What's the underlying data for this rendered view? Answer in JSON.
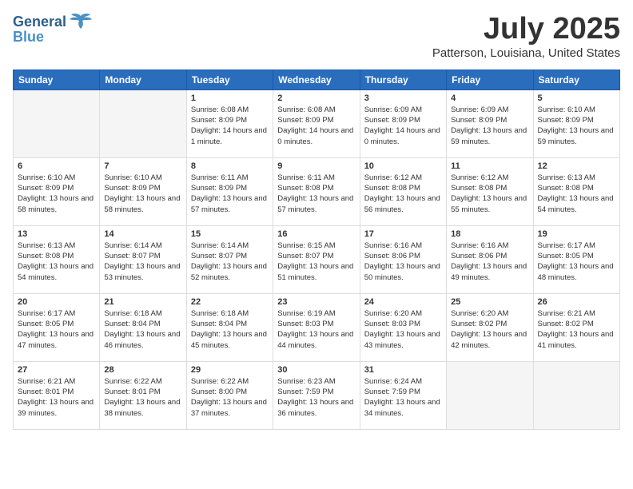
{
  "header": {
    "logo_general": "General",
    "logo_blue": "Blue",
    "month": "July 2025",
    "location": "Patterson, Louisiana, United States"
  },
  "weekdays": [
    "Sunday",
    "Monday",
    "Tuesday",
    "Wednesday",
    "Thursday",
    "Friday",
    "Saturday"
  ],
  "weeks": [
    [
      {
        "day": "",
        "empty": true
      },
      {
        "day": "",
        "empty": true
      },
      {
        "day": "1",
        "sunrise": "6:08 AM",
        "sunset": "8:09 PM",
        "daylight": "14 hours and 1 minute."
      },
      {
        "day": "2",
        "sunrise": "6:08 AM",
        "sunset": "8:09 PM",
        "daylight": "14 hours and 0 minutes."
      },
      {
        "day": "3",
        "sunrise": "6:09 AM",
        "sunset": "8:09 PM",
        "daylight": "14 hours and 0 minutes."
      },
      {
        "day": "4",
        "sunrise": "6:09 AM",
        "sunset": "8:09 PM",
        "daylight": "13 hours and 59 minutes."
      },
      {
        "day": "5",
        "sunrise": "6:10 AM",
        "sunset": "8:09 PM",
        "daylight": "13 hours and 59 minutes."
      }
    ],
    [
      {
        "day": "6",
        "sunrise": "6:10 AM",
        "sunset": "8:09 PM",
        "daylight": "13 hours and 58 minutes."
      },
      {
        "day": "7",
        "sunrise": "6:10 AM",
        "sunset": "8:09 PM",
        "daylight": "13 hours and 58 minutes."
      },
      {
        "day": "8",
        "sunrise": "6:11 AM",
        "sunset": "8:09 PM",
        "daylight": "13 hours and 57 minutes."
      },
      {
        "day": "9",
        "sunrise": "6:11 AM",
        "sunset": "8:08 PM",
        "daylight": "13 hours and 57 minutes."
      },
      {
        "day": "10",
        "sunrise": "6:12 AM",
        "sunset": "8:08 PM",
        "daylight": "13 hours and 56 minutes."
      },
      {
        "day": "11",
        "sunrise": "6:12 AM",
        "sunset": "8:08 PM",
        "daylight": "13 hours and 55 minutes."
      },
      {
        "day": "12",
        "sunrise": "6:13 AM",
        "sunset": "8:08 PM",
        "daylight": "13 hours and 54 minutes."
      }
    ],
    [
      {
        "day": "13",
        "sunrise": "6:13 AM",
        "sunset": "8:08 PM",
        "daylight": "13 hours and 54 minutes."
      },
      {
        "day": "14",
        "sunrise": "6:14 AM",
        "sunset": "8:07 PM",
        "daylight": "13 hours and 53 minutes."
      },
      {
        "day": "15",
        "sunrise": "6:14 AM",
        "sunset": "8:07 PM",
        "daylight": "13 hours and 52 minutes."
      },
      {
        "day": "16",
        "sunrise": "6:15 AM",
        "sunset": "8:07 PM",
        "daylight": "13 hours and 51 minutes."
      },
      {
        "day": "17",
        "sunrise": "6:16 AM",
        "sunset": "8:06 PM",
        "daylight": "13 hours and 50 minutes."
      },
      {
        "day": "18",
        "sunrise": "6:16 AM",
        "sunset": "8:06 PM",
        "daylight": "13 hours and 49 minutes."
      },
      {
        "day": "19",
        "sunrise": "6:17 AM",
        "sunset": "8:05 PM",
        "daylight": "13 hours and 48 minutes."
      }
    ],
    [
      {
        "day": "20",
        "sunrise": "6:17 AM",
        "sunset": "8:05 PM",
        "daylight": "13 hours and 47 minutes."
      },
      {
        "day": "21",
        "sunrise": "6:18 AM",
        "sunset": "8:04 PM",
        "daylight": "13 hours and 46 minutes."
      },
      {
        "day": "22",
        "sunrise": "6:18 AM",
        "sunset": "8:04 PM",
        "daylight": "13 hours and 45 minutes."
      },
      {
        "day": "23",
        "sunrise": "6:19 AM",
        "sunset": "8:03 PM",
        "daylight": "13 hours and 44 minutes."
      },
      {
        "day": "24",
        "sunrise": "6:20 AM",
        "sunset": "8:03 PM",
        "daylight": "13 hours and 43 minutes."
      },
      {
        "day": "25",
        "sunrise": "6:20 AM",
        "sunset": "8:02 PM",
        "daylight": "13 hours and 42 minutes."
      },
      {
        "day": "26",
        "sunrise": "6:21 AM",
        "sunset": "8:02 PM",
        "daylight": "13 hours and 41 minutes."
      }
    ],
    [
      {
        "day": "27",
        "sunrise": "6:21 AM",
        "sunset": "8:01 PM",
        "daylight": "13 hours and 39 minutes."
      },
      {
        "day": "28",
        "sunrise": "6:22 AM",
        "sunset": "8:01 PM",
        "daylight": "13 hours and 38 minutes."
      },
      {
        "day": "29",
        "sunrise": "6:22 AM",
        "sunset": "8:00 PM",
        "daylight": "13 hours and 37 minutes."
      },
      {
        "day": "30",
        "sunrise": "6:23 AM",
        "sunset": "7:59 PM",
        "daylight": "13 hours and 36 minutes."
      },
      {
        "day": "31",
        "sunrise": "6:24 AM",
        "sunset": "7:59 PM",
        "daylight": "13 hours and 34 minutes."
      },
      {
        "day": "",
        "empty": true
      },
      {
        "day": "",
        "empty": true
      }
    ]
  ]
}
